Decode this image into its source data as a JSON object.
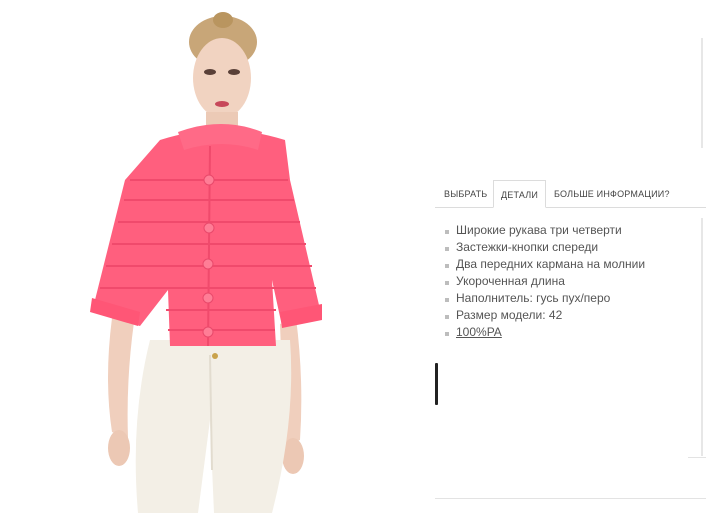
{
  "tabs": {
    "select": "ВЫБРАТЬ",
    "details": "ДЕТАЛИ",
    "more_info": "БОЛЬШЕ ИНФОРМАЦИИ?"
  },
  "details": {
    "items": [
      "Широкие рукава три четверти",
      "Застежки-кнопки спереди",
      "Два передних кармана на молнии",
      "Укороченная длина",
      "Наполнитель: гусь пух/перо",
      "Размер модели: 42"
    ],
    "composition_link": "100%PA"
  },
  "colors": {
    "jacket": "#ff5f7e",
    "pants": "#f3efe6",
    "tab_border": "#dcdcdc",
    "text": "#555555"
  }
}
